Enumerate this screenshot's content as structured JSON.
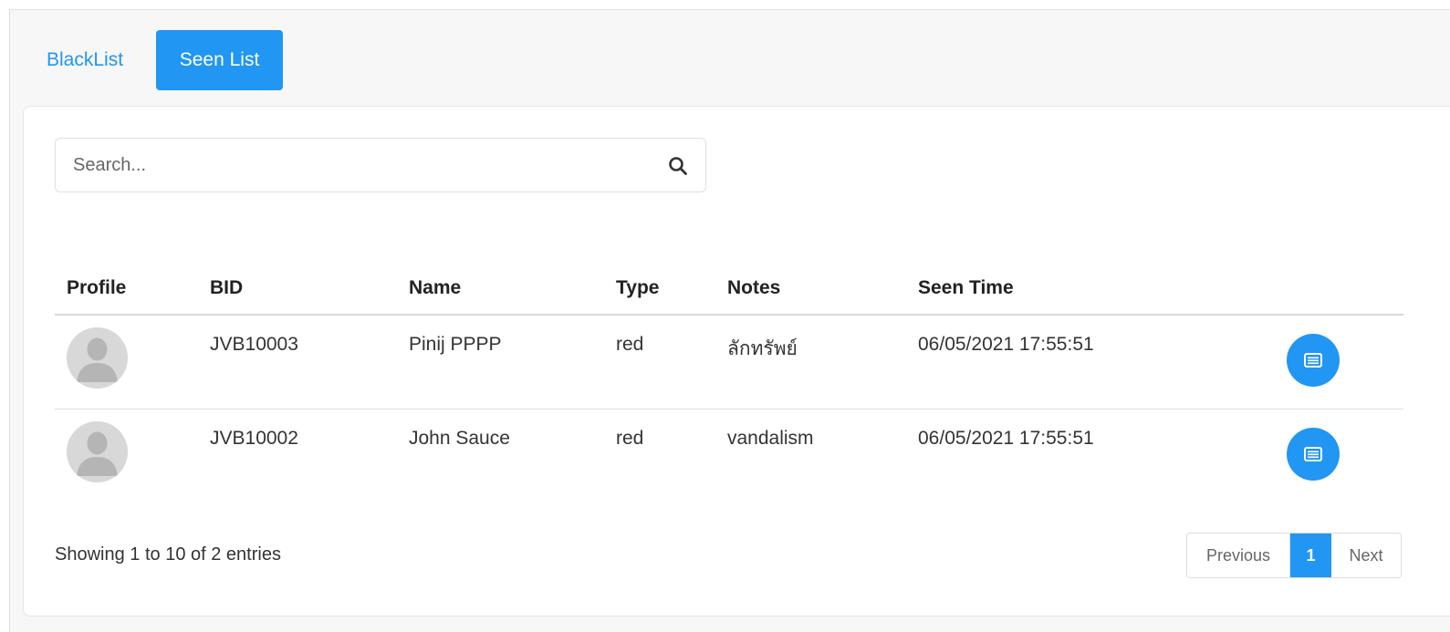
{
  "tabs": [
    {
      "label": "BlackList",
      "active": false
    },
    {
      "label": "Seen List",
      "active": true
    }
  ],
  "search": {
    "placeholder": "Search...",
    "value": ""
  },
  "table": {
    "columns": [
      "Profile",
      "BID",
      "Name",
      "Type",
      "Notes",
      "Seen Time",
      ""
    ],
    "rows": [
      {
        "bid": "JVB10003",
        "name": "Pinij PPPP",
        "type": "red",
        "notes": "ลักทรัพย์",
        "seen_time": "06/05/2021 17:55:51"
      },
      {
        "bid": "JVB10002",
        "name": "John Sauce",
        "type": "red",
        "notes": "vandalism",
        "seen_time": "06/05/2021 17:55:51"
      }
    ]
  },
  "footer": {
    "info": "Showing 1 to 10 of 2 entries"
  },
  "pagination": {
    "previous": "Previous",
    "current": "1",
    "next": "Next"
  },
  "colors": {
    "accent": "#2196f3",
    "avatar_bg": "#d8d8d8",
    "avatar_fg": "#b5b5b5"
  },
  "icons": {
    "search": "search-icon",
    "detail": "list-detail-icon",
    "avatar": "user-silhouette-icon"
  }
}
